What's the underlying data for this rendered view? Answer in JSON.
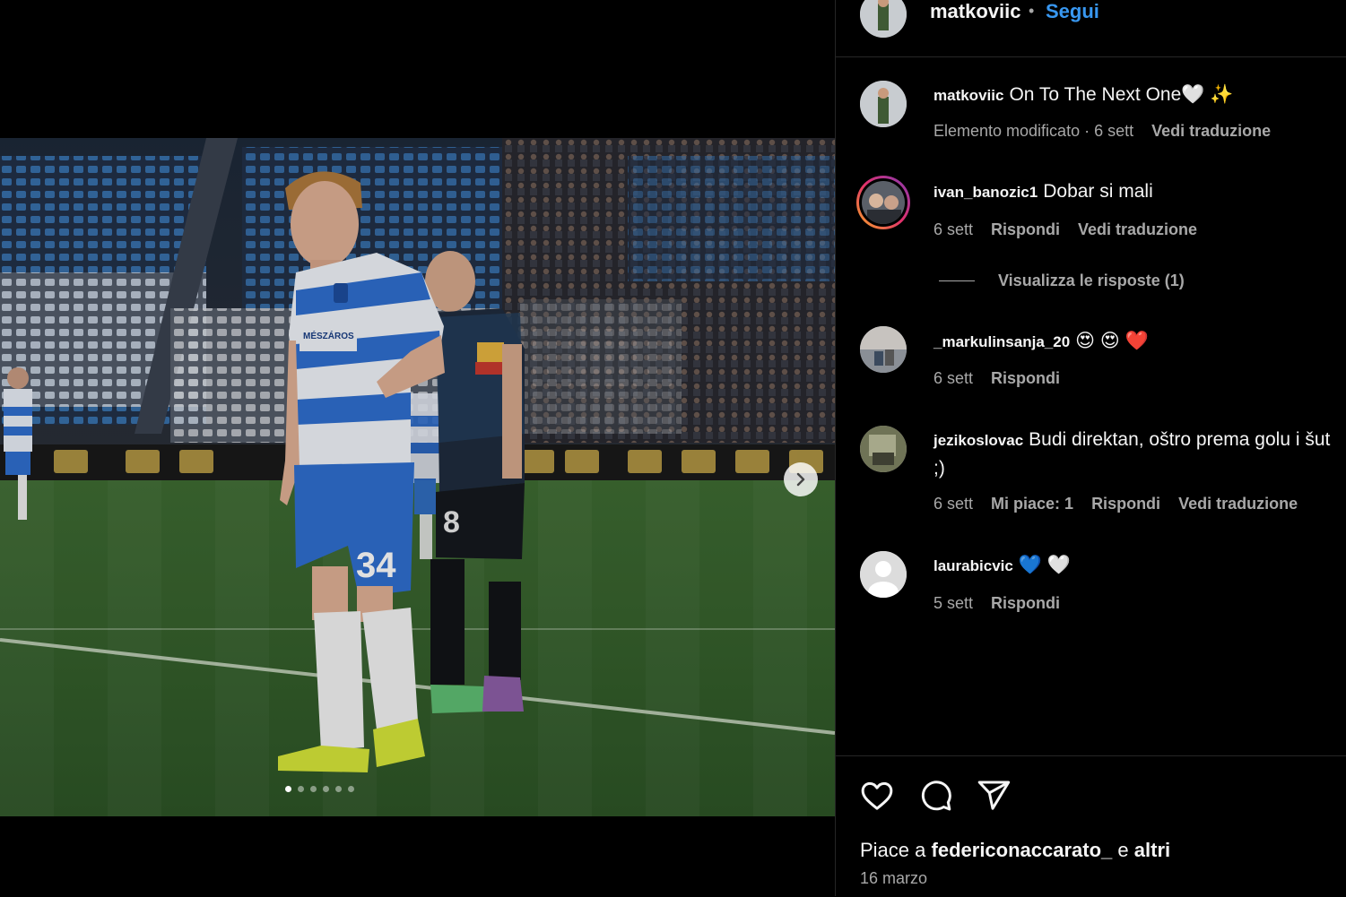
{
  "header": {
    "username": "matkoviic",
    "separator": "•",
    "follow_label": "Segui"
  },
  "caption": {
    "username": "matkoviic",
    "text": "On To The Next One🤍 ✨",
    "edited": "Elemento modificato · 6 sett",
    "translate": "Vedi traduzione"
  },
  "comments": [
    {
      "username": "ivan_banozic1",
      "text": "Dobar si mali",
      "time": "6 sett",
      "reply": "Rispondi",
      "translate": "Vedi traduzione"
    },
    {
      "username": "_markulinsanja_20",
      "text": "😍 😍 ❤️",
      "time": "6 sett",
      "reply": "Rispondi"
    },
    {
      "username": "jezikoslovac",
      "text": "Budi direktan, oštro prema golu i šut",
      "text2": ";)",
      "time": "6 sett",
      "likes": "Mi piace: 1",
      "reply": "Rispondi",
      "translate": "Vedi traduzione"
    },
    {
      "username": "laurabicvic",
      "text": "💙 🤍",
      "time": "5 sett",
      "reply": "Rispondi"
    }
  ],
  "view_replies": "Visualizza le risposte (1)",
  "likes": {
    "prefix": "Piace a",
    "user": "federiconaccarato_",
    "middle": "e",
    "others": "altri"
  },
  "post_date": "16 marzo",
  "photo": {
    "jersey_number": "34",
    "opponent_number": "8",
    "sponsor": "MÉSZÁROS"
  },
  "carousel": {
    "slides": 6,
    "current": 1
  },
  "colors": {
    "follow": "#3897f0",
    "background": "#000000",
    "muted": "#a8a8a8",
    "kit_blue": "#2f6fd0"
  }
}
